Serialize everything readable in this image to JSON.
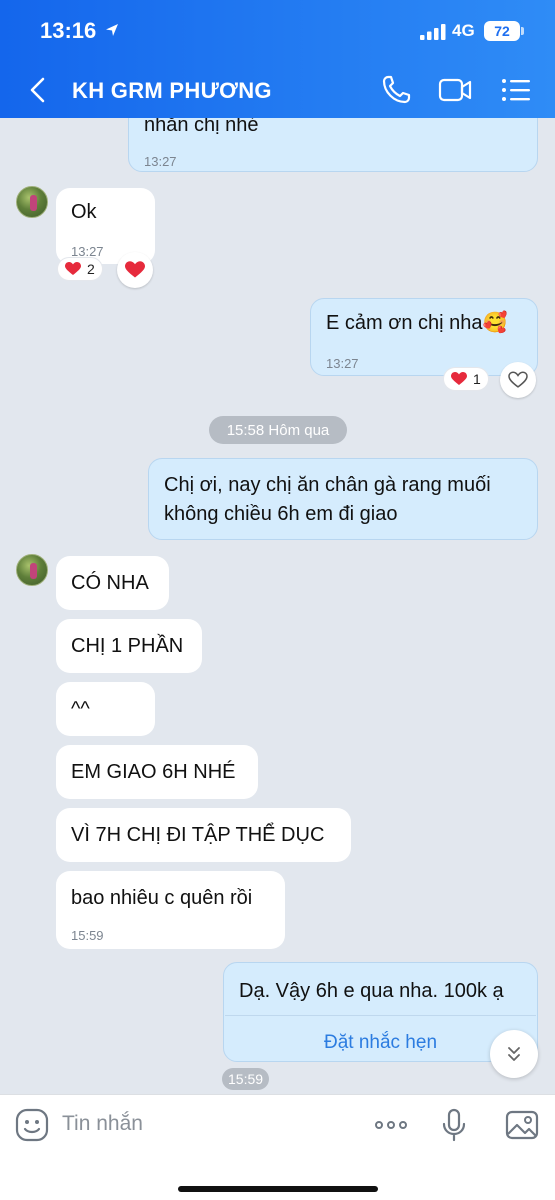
{
  "status_bar": {
    "time": "13:16",
    "network": "4G",
    "battery": "72"
  },
  "header": {
    "title": "KH GRM PHƯƠNG"
  },
  "messages": {
    "m1": {
      "text": "nhắn chị nhé",
      "time": "13:27"
    },
    "m2": {
      "text": "Ok",
      "time": "13:27",
      "reaction": "❤️",
      "reaction_count": "2"
    },
    "m3": {
      "text": "E cảm ơn chị nha🥰",
      "time": "13:27",
      "reaction": "❤️",
      "reaction_count": "1"
    },
    "divider": "15:58 Hôm qua",
    "m4": {
      "line1": "Chị ơi, nay chị ăn chân gà rang muối",
      "line2": "không chiều 6h em đi giao"
    },
    "m5": {
      "text": "CÓ NHA"
    },
    "m6": {
      "text": "CHỊ 1 PHẦN"
    },
    "m7": {
      "text": "^^"
    },
    "m8": {
      "text": "EM GIAO 6H NHÉ"
    },
    "m9": {
      "text": "VÌ 7H CHỊ ĐI TẬP THỂ DỤC"
    },
    "m10": {
      "text": "bao nhiêu c quên rồi",
      "time": "15:59"
    },
    "m11": {
      "text": "Dạ. Vậy 6h e qua nha. 100k ạ",
      "reminder": "Đặt nhắc hẹn"
    },
    "last_time": "15:59"
  },
  "composer": {
    "placeholder": "Tin nhắn"
  },
  "colors": {
    "header_start": "#1466ec",
    "header_end": "#2f8cf6",
    "outgoing_bubble": "#d5ecfd",
    "link": "#2c7ce0"
  },
  "icons": [
    "location-arrow-icon",
    "signal-icon",
    "back-icon",
    "phone-icon",
    "video-icon",
    "menu-icon",
    "heart-icon",
    "heart-outline-icon",
    "chevron-double-down-icon",
    "sticker-icon",
    "more-icon",
    "microphone-icon",
    "image-icon"
  ]
}
